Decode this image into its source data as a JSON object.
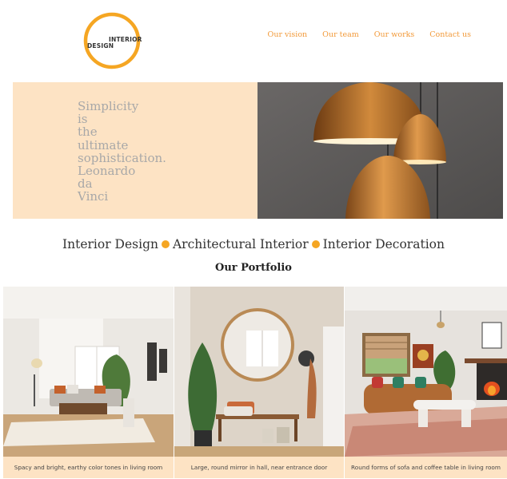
{
  "header": {
    "logo": {
      "line1": "INTERIOR",
      "line2": "DESIGN",
      "ring_color": "#f5a623"
    },
    "nav": [
      {
        "label": "Our vision"
      },
      {
        "label": "Our team"
      },
      {
        "label": "Our works"
      },
      {
        "label": "Contact us"
      }
    ]
  },
  "hero": {
    "quote": "Simplicity\nis\nthe\nultimate\nsophistication.\nLeonardo\nda\nVinci",
    "panel_color": "#fde3c4"
  },
  "services": [
    {
      "label": "Interior Design"
    },
    {
      "label": "Architectural Interior"
    },
    {
      "label": "Interior Decoration"
    }
  ],
  "portfolio": {
    "title": "Our Portfolio",
    "items": [
      {
        "caption": "Spacy and bright, earthy color tones in living room"
      },
      {
        "caption": "Large, round mirror in hall, near entrance door"
      },
      {
        "caption": "Round forms of sofa and coffee table in living room"
      }
    ]
  },
  "colors": {
    "accent": "#f29a3a",
    "dot": "#f5a623",
    "peach": "#fde3c4"
  }
}
